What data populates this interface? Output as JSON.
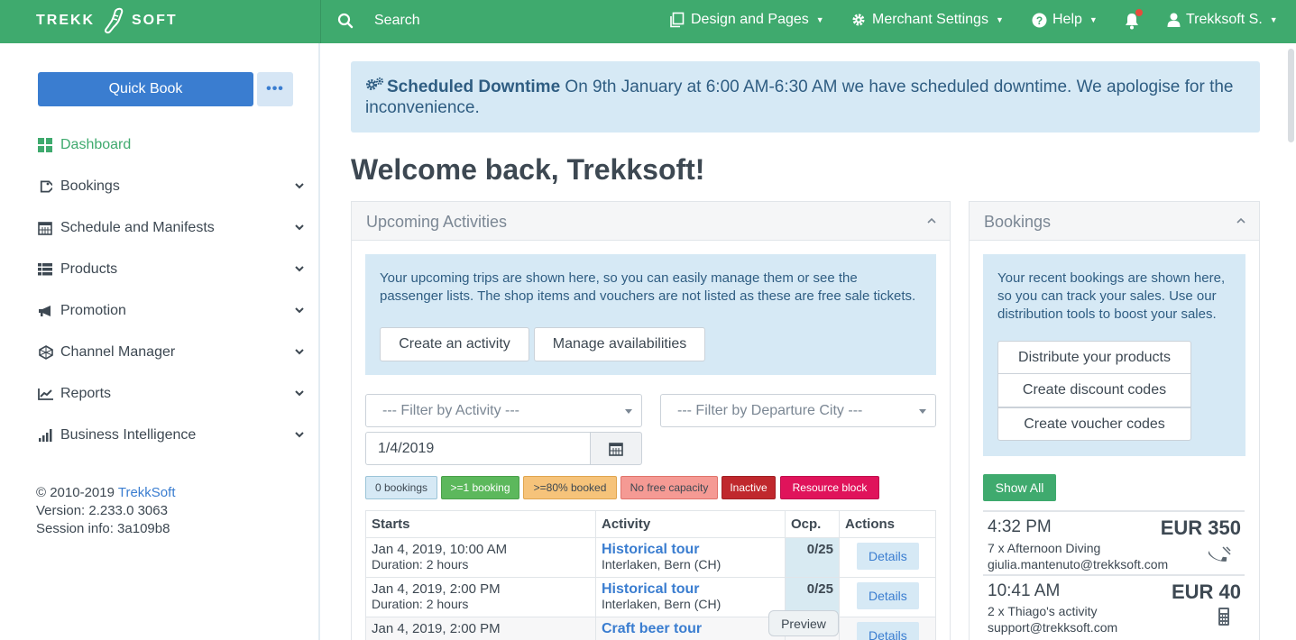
{
  "topbar": {
    "brand_left": "TREKK",
    "brand_right": "SOFT",
    "search_label": "Search",
    "design_label": "Design and Pages",
    "merchant_label": "Merchant Settings",
    "help_label": "Help",
    "user_label": "Trekksoft S."
  },
  "sidebar": {
    "quick_book": "Quick Book",
    "more": "•••",
    "items": [
      {
        "label": "Dashboard",
        "icon": "dashboard-icon"
      },
      {
        "label": "Bookings",
        "icon": "tag-icon"
      },
      {
        "label": "Schedule and Manifests",
        "icon": "calendar-icon"
      },
      {
        "label": "Products",
        "icon": "list-icon"
      },
      {
        "label": "Promotion",
        "icon": "megaphone-icon"
      },
      {
        "label": "Channel Manager",
        "icon": "network-icon"
      },
      {
        "label": "Reports",
        "icon": "line-chart-icon"
      },
      {
        "label": "Business Intelligence",
        "icon": "bar-chart-icon"
      }
    ],
    "footer": {
      "copyright_prefix": "© 2010-2019 ",
      "copyright_link": "TrekkSoft",
      "version": "Version: 2.233.0 3063",
      "session": "Session info: 3a109b8"
    }
  },
  "banner": {
    "title": "Scheduled Downtime",
    "text": " On 9th January at 6:00 AM-6:30 AM we have scheduled downtime. We apologise for the inconvenience."
  },
  "welcome": "Welcome back, Trekksoft!",
  "upcoming": {
    "title": "Upcoming Activities",
    "info": "Your upcoming trips are shown here, so you can easily manage them or see the passenger lists. The shop items and vouchers are not listed as these are free sale tickets.",
    "create_activity": "Create an activity",
    "manage_avail": "Manage availabilities",
    "filter_activity": "--- Filter by Activity ---",
    "filter_city": "--- Filter by Departure City ---",
    "date": "1/4/2019",
    "legend": [
      {
        "label": "0 bookings",
        "bg": "#d6e9f5",
        "fg": "#3d4852",
        "border": "#9bc4d8"
      },
      {
        "label": ">=1 booking",
        "bg": "#5cb85c",
        "fg": "#ffffff",
        "border": "#4a9f4a"
      },
      {
        "label": ">=80% booked",
        "bg": "#f6c37a",
        "fg": "#3d4852",
        "border": "#e0a54f"
      },
      {
        "label": "No free capacity",
        "bg": "#f59a94",
        "fg": "#3d4852",
        "border": "#e0736b"
      },
      {
        "label": "Inactive",
        "bg": "#c0282d",
        "fg": "#ffffff",
        "border": "#a01f23"
      },
      {
        "label": "Resource block",
        "bg": "#e0135b",
        "fg": "#ffffff",
        "border": "#c00f4d"
      }
    ],
    "columns": [
      "Starts",
      "Activity",
      "Ocp.",
      "Actions"
    ],
    "rows": [
      {
        "start": "Jan 4, 2019, 10:00 AM",
        "duration": "Duration: 2 hours",
        "activity": "Historical tour",
        "location": "Interlaken, Bern (CH)",
        "ocp": "0/25",
        "action": "Details"
      },
      {
        "start": "Jan 4, 2019, 2:00 PM",
        "duration": "Duration: 2 hours",
        "activity": "Historical tour",
        "location": "Interlaken, Bern (CH)",
        "ocp": "0/25",
        "action": "Details"
      },
      {
        "start": "Jan 4, 2019, 2:00 PM",
        "duration": "",
        "activity": "Craft beer tour",
        "location": "",
        "ocp": "",
        "action": "Details"
      }
    ],
    "preview": "Preview"
  },
  "bookings": {
    "title": "Bookings",
    "info": "Your recent bookings are shown here, so you can track your sales. Use our distribution tools to boost your sales.",
    "distribute": "Distribute your products",
    "discount": "Create discount codes",
    "voucher": "Create voucher codes",
    "show_all": "Show All",
    "items": [
      {
        "time": "4:32 PM",
        "price": "EUR 350",
        "desc": "7 x Afternoon Diving",
        "email": "giulia.mantenuto@trekksoft.com",
        "icon": "phone-icon"
      },
      {
        "time": "10:41 AM",
        "price": "EUR 40",
        "desc": "2 x Thiago's activity",
        "email": "support@trekksoft.com",
        "icon": "calculator-icon"
      }
    ]
  },
  "colors": {
    "brand_green": "#3faa6e",
    "primary_blue": "#3a7dd0",
    "info_bg": "#d6e9f5"
  }
}
